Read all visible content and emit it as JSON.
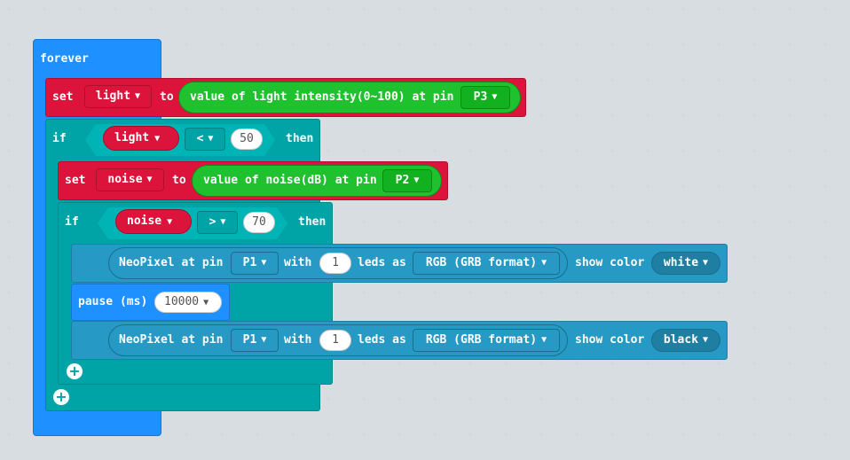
{
  "forever": {
    "label": "forever"
  },
  "set1": {
    "set_label": "set",
    "var": "light",
    "to_label": "to",
    "expr_label": "value of light intensity(0~100) at pin",
    "pin": "P3"
  },
  "if1": {
    "if_label": "if",
    "var": "light",
    "op": "<",
    "value": "50",
    "then_label": "then"
  },
  "set2": {
    "set_label": "set",
    "var": "noise",
    "to_label": "to",
    "expr_label": "value of noise(dB) at pin",
    "pin": "P2"
  },
  "if2": {
    "if_label": "if",
    "var": "noise",
    "op": ">",
    "value": "70",
    "then_label": "then"
  },
  "neo1": {
    "label": "NeoPixel at pin",
    "pin": "P1",
    "with_label": "with",
    "count": "1",
    "leds_label": "leds as",
    "format": "RGB (GRB format)",
    "show_label": "show color",
    "color": "white"
  },
  "pause": {
    "label": "pause (ms)",
    "value": "10000"
  },
  "neo2": {
    "label": "NeoPixel at pin",
    "pin": "P1",
    "with_label": "with",
    "count": "1",
    "leds_label": "leds as",
    "format": "RGB (GRB format)",
    "show_label": "show color",
    "color": "black"
  },
  "icons": {
    "dropdown": "chevron-down-icon",
    "add": "plus-circle-icon"
  },
  "colors": {
    "forever": "#1e90ff",
    "logic": "#00a4a6",
    "variables": "#dc143c",
    "sensor": "#1fc22e",
    "neopixel": "#2699c4",
    "background": "#eceff1"
  }
}
